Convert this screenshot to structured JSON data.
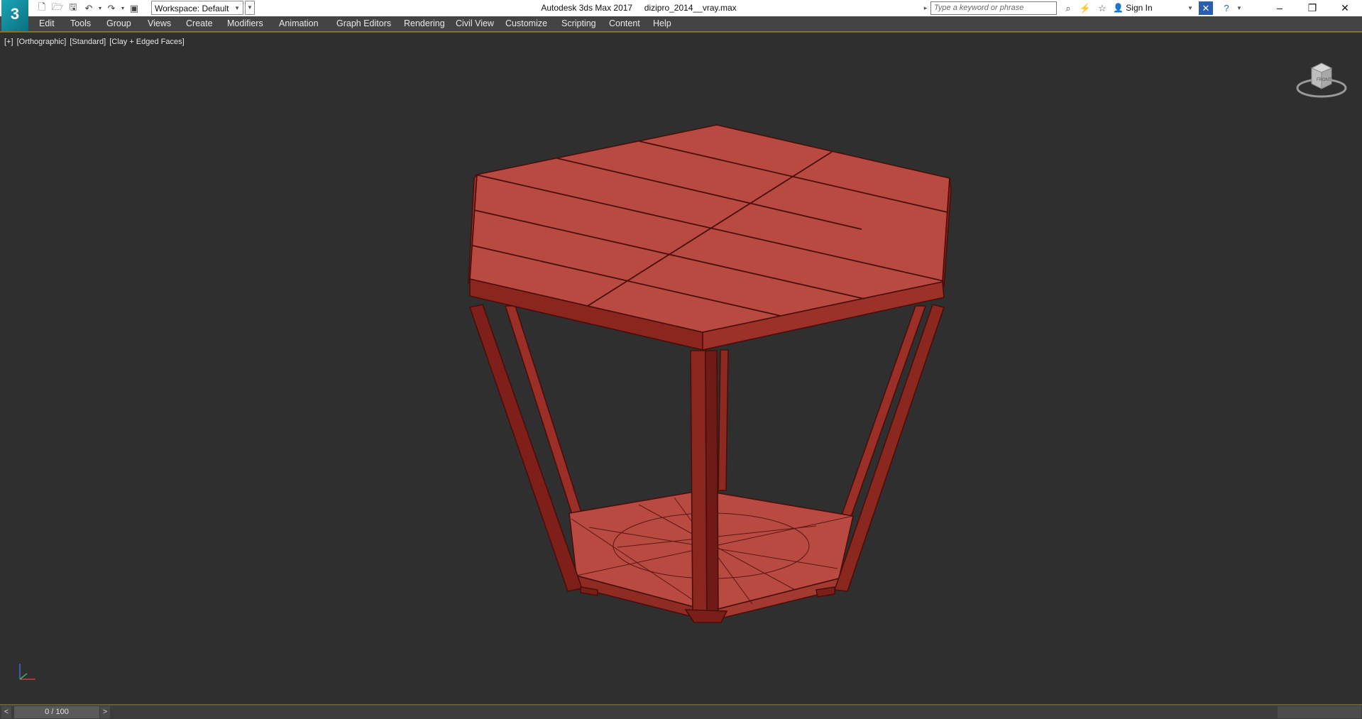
{
  "app": {
    "logo_text": "3",
    "window_title": "Autodesk 3ds Max 2017",
    "file_name": "dizipro_2014__vray.max"
  },
  "quick_access": {
    "workspace_label": "Workspace: Default"
  },
  "search": {
    "placeholder": "Type a keyword or phrase"
  },
  "account": {
    "sign_in_label": "Sign In"
  },
  "window_controls": {
    "minimize": "–",
    "restore": "❐",
    "close": "✕"
  },
  "menu": [
    "Edit",
    "Tools",
    "Group",
    "Views",
    "Create",
    "Modifiers",
    "Animation",
    "Graph Editors",
    "Rendering",
    "Civil View",
    "Customize",
    "Scripting",
    "Content",
    "Help"
  ],
  "viewport": {
    "labels": [
      "[+]",
      "[Orthographic]",
      "[Standard]",
      "[Clay + Edged Faces]"
    ],
    "viewcube_face": "FRONT",
    "model_color": "#b84a42",
    "edge_color": "#4a0e0a"
  },
  "timeline": {
    "prev": "<",
    "next": ">",
    "frame_display": "0 / 100"
  },
  "colors": {
    "viewport_bg": "#2f2f2f",
    "menubar_bg": "#444444",
    "accent_border": "#8a7a2a"
  }
}
